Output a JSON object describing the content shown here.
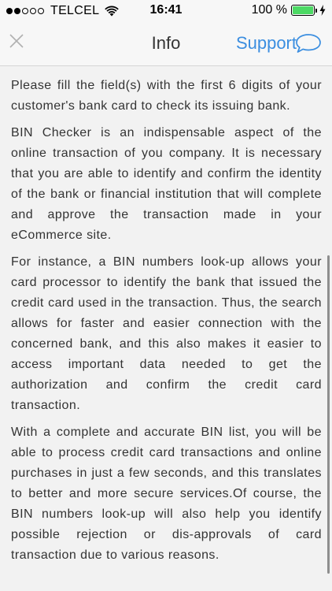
{
  "status_bar": {
    "carrier": "TELCEL",
    "time": "16:41",
    "battery_percent": "100 %",
    "signal_bars_filled": 2,
    "signal_bars_total": 5,
    "battery_level": 1.0,
    "battery_color": "#4cd964",
    "icons": [
      "wifi-icon",
      "battery-icon",
      "charging-bolt-icon"
    ]
  },
  "nav": {
    "title": "Info",
    "close_icon": "close-icon",
    "support_label": "Support",
    "support_icon": "chat-bubble-icon",
    "accent_color": "#3b8ee0"
  },
  "content": {
    "paragraphs": [
      "Please fill the field(s) with the first 6 digits of your customer's bank card to check its issuing bank.",
      "BIN Checker is an indispensable aspect of the online transaction of you company. It is necessary that you are able to identify and confirm the identity of the bank or financial institution that will complete and approve the transaction made in your eCommerce site.",
      "For instance, a BIN numbers look-up allows your card processor to identify the bank that issued the credit card used in the transaction. Thus, the search allows for faster and easier connection with the concerned bank, and this also makes it easier to access important data needed to get the authorization and confirm the credit card transaction.",
      "With a complete and accurate BIN list, you will be able to process credit card transactions and online purchases in just a few seconds, and this translates to better and more secure services.Of course, the BIN numbers look-up will also help you identify possible rejection or dis-approvals of card transaction due to various reasons."
    ]
  }
}
